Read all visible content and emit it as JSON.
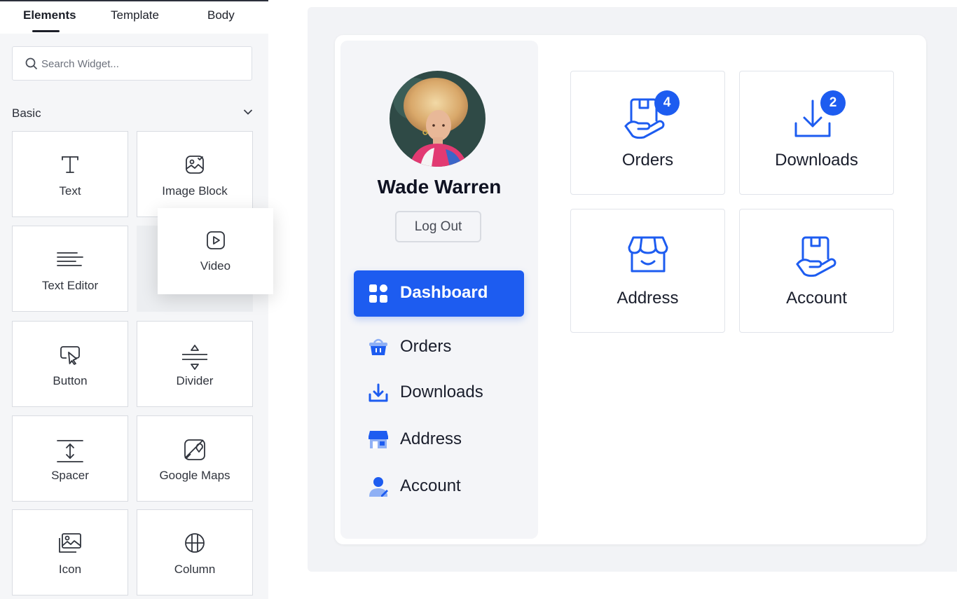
{
  "editor": {
    "tabs": [
      {
        "label": "Elements",
        "active": true
      },
      {
        "label": "Template",
        "active": false
      },
      {
        "label": "Body",
        "active": false
      }
    ],
    "search": {
      "placeholder": "Search Widget...",
      "value": ""
    },
    "section": {
      "title": "Basic",
      "expanded": true
    },
    "widgets": [
      {
        "label": "Text",
        "icon": "text-icon"
      },
      {
        "label": "Image Block",
        "icon": "image-block-icon"
      },
      {
        "label": "Text Editor",
        "icon": "text-editor-icon"
      },
      {
        "label": "Button",
        "icon": "button-pointer-icon"
      },
      {
        "label": "Divider",
        "icon": "divider-icon"
      },
      {
        "label": "Spacer",
        "icon": "spacer-icon"
      },
      {
        "label": "Google Maps",
        "icon": "map-icon"
      },
      {
        "label": "Icon",
        "icon": "image-icon"
      },
      {
        "label": "Column",
        "icon": "column-grid-icon"
      }
    ],
    "dragging_widget": {
      "label": "Video",
      "icon": "video-play-icon"
    }
  },
  "preview": {
    "user": {
      "name": "Wade Warren",
      "logout_label": "Log Out"
    },
    "nav": [
      {
        "label": "Dashboard",
        "icon": "dashboard-grid-icon",
        "active": true
      },
      {
        "label": "Orders",
        "icon": "basket-icon",
        "active": false
      },
      {
        "label": "Downloads",
        "icon": "download-icon",
        "active": false
      },
      {
        "label": "Address",
        "icon": "store-icon",
        "active": false
      },
      {
        "label": "Account",
        "icon": "user-edit-icon",
        "active": false
      }
    ],
    "tiles": [
      {
        "label": "Orders",
        "icon": "box-hand-icon",
        "badge": "4"
      },
      {
        "label": "Downloads",
        "icon": "download-tray-icon",
        "badge": "2"
      },
      {
        "label": "Address",
        "icon": "store-icon",
        "badge": ""
      },
      {
        "label": "Account",
        "icon": "box-hand-icon",
        "badge": ""
      }
    ]
  },
  "colors": {
    "accent": "#1d5cf0",
    "text_dark": "#1a1e2c",
    "panel_bg": "#f5f6f8",
    "canvas_bg": "#f2f3f6"
  }
}
